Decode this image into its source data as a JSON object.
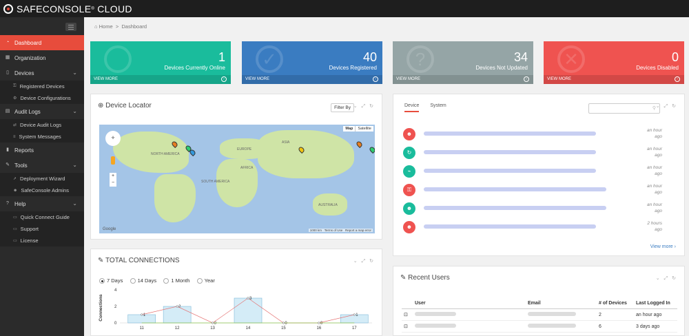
{
  "brand": {
    "name": "SAFECONSOLE",
    "suffix": "CLOUD",
    "reg": "®"
  },
  "sidebar": {
    "items": [
      {
        "label": "Dashboard",
        "icon": "tachometer-icon"
      },
      {
        "label": "Organization",
        "icon": "building-icon"
      },
      {
        "label": "Devices",
        "icon": "usb-icon"
      },
      {
        "label": "Audit Logs",
        "icon": "log-icon"
      },
      {
        "label": "Reports",
        "icon": "bar-chart-icon"
      },
      {
        "label": "Tools",
        "icon": "wrench-icon"
      },
      {
        "label": "Help",
        "icon": "help-icon"
      }
    ],
    "devices_sub": [
      "Registered Devices",
      "Device Configurations"
    ],
    "audit_sub": [
      "Device Audit Logs",
      "System Messages"
    ],
    "tools_sub": [
      "Deployment Wizard",
      "SafeConsole Admins"
    ],
    "help_sub": [
      "Quick Connect Guide",
      "Support",
      "License"
    ]
  },
  "breadcrumb": {
    "home": "Home",
    "sep": ">",
    "current": "Dashboard"
  },
  "stats": [
    {
      "value": "1",
      "label": "Devices Currently Online",
      "more": "VIEW MORE",
      "color": "#1abc9c"
    },
    {
      "value": "40",
      "label": "Devices Registered",
      "more": "VIEW MORE",
      "color": "#3a7cc1"
    },
    {
      "value": "34",
      "label": "Devices Not Updated",
      "more": "VIEW MORE",
      "color": "#95a5a6"
    },
    {
      "value": "0",
      "label": "Devices Disabled",
      "more": "VIEW MORE",
      "color": "#ef5350"
    }
  ],
  "locator": {
    "title": "Device Locator",
    "filter": "Filter By",
    "map_btn": "Map",
    "sat_btn": "Satellite",
    "google": "Google",
    "scale": "1000 km",
    "terms": "Terms of Use",
    "report": "Report a map error",
    "labels": {
      "na": "NORTH AMERICA",
      "sa": "SOUTH AMERICA",
      "eu": "EUROPE",
      "af": "AFRICA",
      "asia": "ASIA",
      "au": "AUSTRALIA"
    }
  },
  "activity": {
    "tabs": [
      "Device",
      "System"
    ],
    "times": [
      "an hour ago",
      "an hour ago",
      "an hour ago",
      "an hour ago",
      "an hour ago",
      "2 hours ago"
    ],
    "view_more": "View more"
  },
  "connections": {
    "title": "TOTAL CONNECTIONS",
    "ranges": [
      "7 Days",
      "14 Days",
      "1 Month",
      "Year"
    ],
    "ylabel": "Connections"
  },
  "chart_data": {
    "type": "bar",
    "categories": [
      "11",
      "12",
      "13",
      "14",
      "15",
      "16",
      "17"
    ],
    "values": [
      1,
      2,
      0,
      3,
      0,
      0,
      1
    ],
    "ylabel": "Connections",
    "ylim": [
      0,
      4
    ],
    "yticks": [
      0,
      2,
      4
    ]
  },
  "recent": {
    "title": "Recent Users",
    "headers": [
      "User",
      "Email",
      "# of Devices",
      "Last Logged In"
    ],
    "rows": [
      {
        "devices": "2",
        "last": "an hour ago"
      },
      {
        "devices": "6",
        "last": "3 days ago"
      }
    ]
  }
}
